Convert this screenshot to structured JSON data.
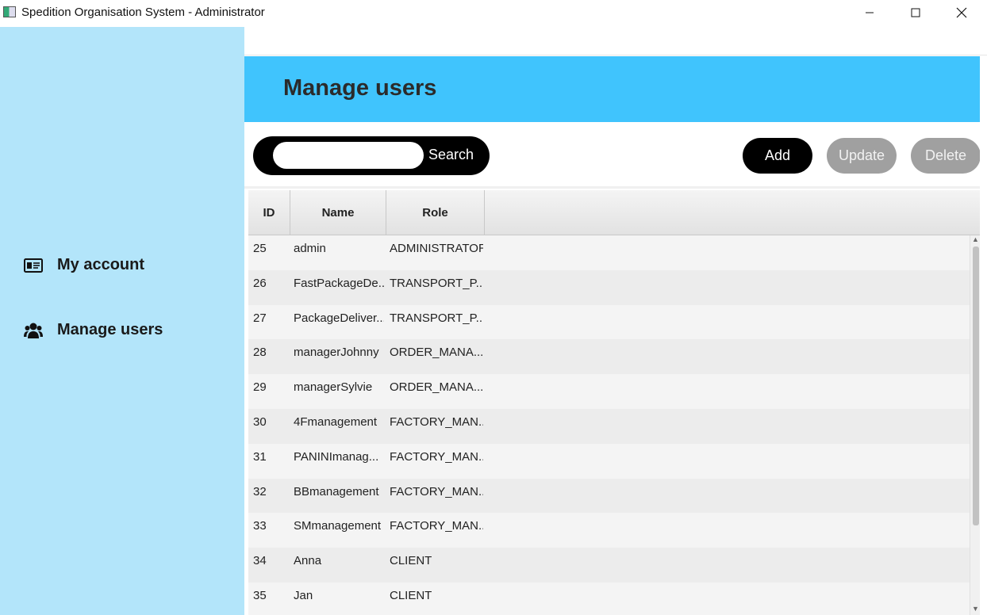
{
  "window": {
    "title": "Spedition Organisation System - Administrator",
    "minimize_glyph": "—",
    "maximize_glyph": "☐",
    "close_glyph": "✕"
  },
  "sidebar": {
    "items": [
      {
        "label": "My account",
        "icon": "id-card-icon"
      },
      {
        "label": "Manage users",
        "icon": "users-icon"
      }
    ]
  },
  "header": {
    "title": "Manage users"
  },
  "toolbar": {
    "search_value": "",
    "search_label": "Search",
    "add_label": "Add",
    "update_label": "Update",
    "delete_label": "Delete"
  },
  "table": {
    "columns": [
      "ID",
      "Name",
      "Role"
    ],
    "rows": [
      {
        "id": "25",
        "name": "admin",
        "role": "ADMINISTRATOR"
      },
      {
        "id": "26",
        "name": "FastPackageDe...",
        "role": "TRANSPORT_P..."
      },
      {
        "id": "27",
        "name": "PackageDeliver...",
        "role": "TRANSPORT_P..."
      },
      {
        "id": "28",
        "name": "managerJohnny",
        "role": "ORDER_MANA..."
      },
      {
        "id": "29",
        "name": "managerSylvie",
        "role": "ORDER_MANA..."
      },
      {
        "id": "30",
        "name": "4Fmanagement",
        "role": "FACTORY_MAN..."
      },
      {
        "id": "31",
        "name": "PANINImanag...",
        "role": "FACTORY_MAN..."
      },
      {
        "id": "32",
        "name": "BBmanagement",
        "role": "FACTORY_MAN..."
      },
      {
        "id": "33",
        "name": "SMmanagement",
        "role": "FACTORY_MAN..."
      },
      {
        "id": "34",
        "name": "Anna",
        "role": "CLIENT"
      },
      {
        "id": "35",
        "name": "Jan",
        "role": "CLIENT"
      }
    ]
  },
  "colors": {
    "sidebar_bg": "#b3e5fa",
    "header_bg": "#40c4fd",
    "primary_button": "#000000",
    "disabled_button": "#a0a0a0"
  }
}
